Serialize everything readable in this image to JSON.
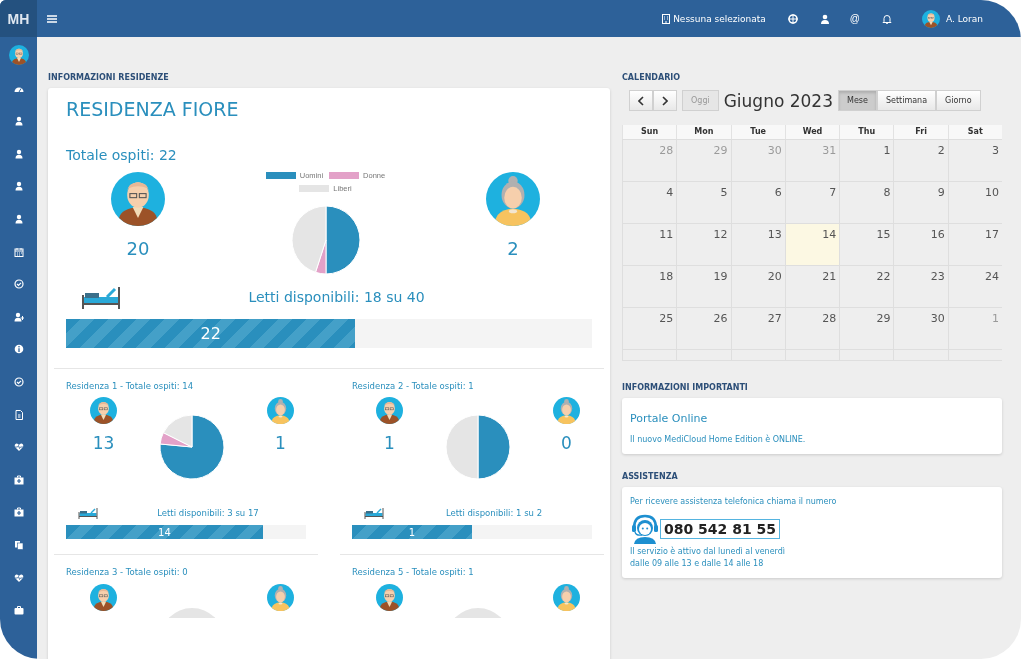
{
  "topbar": {
    "logo": "MH",
    "facility": "Nessuna selezionata",
    "at": "@",
    "user": "A. Loran"
  },
  "residences": {
    "label": "INFORMAZIONI RESIDENZE",
    "title": "RESIDENZA FIORE",
    "total": "Totale ospiti: 22",
    "men": "20",
    "women": "2",
    "beds": "Letti disponibili: 18 su 40",
    "occupied": "22",
    "level": 0.55,
    "legend": [
      {
        "label": "Uomini",
        "color": "#2a8fbd"
      },
      {
        "label": "Donne",
        "color": "#e3a1c8"
      },
      {
        "label": "Liberi",
        "color": "#e5e5e5"
      }
    ],
    "chart_data": {
      "type": "pie",
      "values": [
        50,
        5,
        45
      ]
    }
  },
  "sub_residences": [
    {
      "kind": "full",
      "title": "Residenza 1 - Totale ospiti: 14",
      "men": "13",
      "women": "1",
      "beds": "Letti disponibili: 3 su 17",
      "occupied": "14",
      "level": 0.82,
      "chart_data": {
        "type": "pie",
        "values": [
          76.5,
          5.9,
          17.6
        ]
      }
    },
    {
      "kind": "full",
      "title": "Residenza 2 - Totale ospiti: 1",
      "men": "1",
      "women": "0",
      "beds": "Letti disponibili: 1 su 2",
      "occupied": "1",
      "level": 0.5,
      "chart_data": {
        "type": "pie",
        "values": [
          50,
          0,
          50
        ]
      }
    },
    {
      "kind": "cut",
      "title": "Residenza 3 - Totale ospiti: 0"
    },
    {
      "kind": "cut",
      "title": "Residenza 5 - Totale ospiti: 1"
    }
  ],
  "calendar": {
    "label": "CALENDARIO",
    "today_button": {
      "label": "Oggi",
      "disabled": true
    },
    "month": "Giugno 2023",
    "views": [
      {
        "label": "Mese",
        "selected": true
      },
      {
        "label": "Settimana",
        "selected": false
      },
      {
        "label": "Giorno",
        "selected": false
      }
    ],
    "weekdays": [
      "Sun",
      "Mon",
      "Tue",
      "Wed",
      "Thu",
      "Fri",
      "Sat"
    ],
    "weeks": [
      [
        {
          "day": "28",
          "muted": true,
          "today": false
        },
        {
          "day": "29",
          "muted": true,
          "today": false
        },
        {
          "day": "30",
          "muted": true,
          "today": false
        },
        {
          "day": "31",
          "muted": true,
          "today": false
        },
        {
          "day": "1",
          "muted": false,
          "today": false
        },
        {
          "day": "2",
          "muted": false,
          "today": false
        },
        {
          "day": "3",
          "muted": false,
          "today": false
        }
      ],
      [
        {
          "day": "4",
          "muted": false,
          "today": false
        },
        {
          "day": "5",
          "muted": false,
          "today": false
        },
        {
          "day": "6",
          "muted": false,
          "today": false
        },
        {
          "day": "7",
          "muted": false,
          "today": false
        },
        {
          "day": "8",
          "muted": false,
          "today": false
        },
        {
          "day": "9",
          "muted": false,
          "today": false
        },
        {
          "day": "10",
          "muted": false,
          "today": false
        }
      ],
      [
        {
          "day": "11",
          "muted": false,
          "today": false
        },
        {
          "day": "12",
          "muted": false,
          "today": false
        },
        {
          "day": "13",
          "muted": false,
          "today": false
        },
        {
          "day": "14",
          "muted": false,
          "today": true
        },
        {
          "day": "15",
          "muted": false,
          "today": false
        },
        {
          "day": "16",
          "muted": false,
          "today": false
        },
        {
          "day": "17",
          "muted": false,
          "today": false
        }
      ],
      [
        {
          "day": "18",
          "muted": false,
          "today": false
        },
        {
          "day": "19",
          "muted": false,
          "today": false
        },
        {
          "day": "20",
          "muted": false,
          "today": false
        },
        {
          "day": "21",
          "muted": false,
          "today": false
        },
        {
          "day": "22",
          "muted": false,
          "today": false
        },
        {
          "day": "23",
          "muted": false,
          "today": false
        },
        {
          "day": "24",
          "muted": false,
          "today": false
        }
      ],
      [
        {
          "day": "25",
          "muted": false,
          "today": false
        },
        {
          "day": "26",
          "muted": false,
          "today": false
        },
        {
          "day": "27",
          "muted": false,
          "today": false
        },
        {
          "day": "28",
          "muted": false,
          "today": false
        },
        {
          "day": "29",
          "muted": false,
          "today": false
        },
        {
          "day": "30",
          "muted": false,
          "today": false
        },
        {
          "day": "1",
          "muted": true,
          "today": false
        }
      ]
    ]
  },
  "info": {
    "label": "INFORMAZIONI IMPORTANTI",
    "title": "Portale Online",
    "text": "Il nuovo MediCloud Home Edition è ONLINE."
  },
  "assist": {
    "label": "ASSISTENZA",
    "intro": "Per ricevere assistenza telefonica chiama il numero",
    "phone": "080 542 81 55",
    "hours": [
      "Il servizio è attivo dal lunedì al venerdì",
      "dalle 09 alle 13 e dalle 14 alle 18"
    ]
  }
}
